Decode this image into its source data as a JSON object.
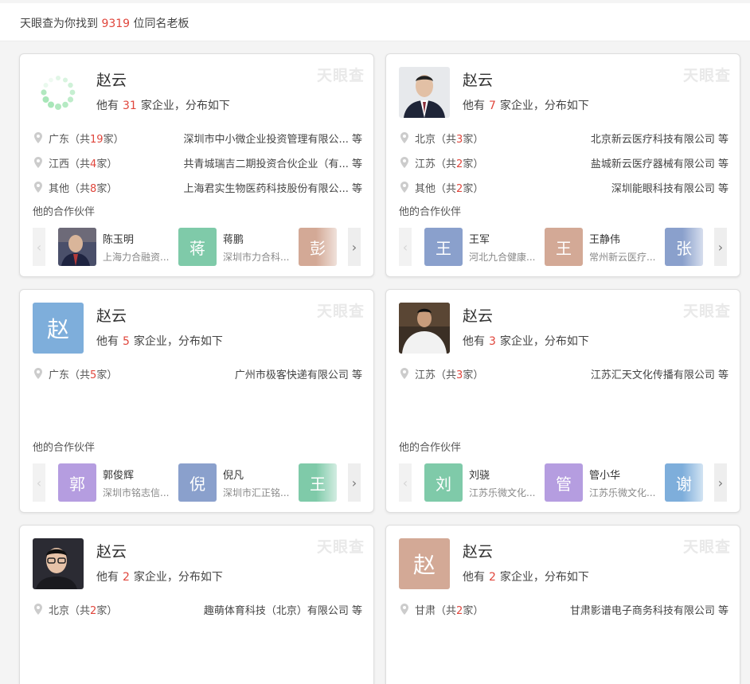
{
  "header": {
    "prefix": "天眼查为你找到",
    "count": "9319",
    "suffix": "位同名老板"
  },
  "watermark": "天眼查",
  "colors": {
    "accent_red": "#e0463c",
    "blue": "#7eaedb",
    "tan": "#d3a996",
    "green": "#7fcaa9",
    "purple": "#b59de0",
    "slate": "#8aa0cc"
  },
  "labels": {
    "count_prefix": "他有",
    "count_suffix": "家企业，分布如下",
    "partners_title": "他的合作伙伴",
    "etc": "等",
    "total_open": "（共",
    "total_close": "家）"
  },
  "cards": [
    {
      "name": "赵云",
      "count": "31",
      "avatar_type": "spinner",
      "locations": [
        {
          "province": "广东",
          "total": "19",
          "company": "深圳市中小微企业投资管理有限公..."
        },
        {
          "province": "江西",
          "total": "4",
          "company": "共青城瑞吉二期投资合伙企业（有..."
        },
        {
          "province": "其他",
          "total": "8",
          "company": "上海君实生物医药科技股份有限公..."
        }
      ],
      "partners": [
        {
          "name": "陈玉明",
          "company": "上海力合融资...",
          "avatar_type": "photo"
        },
        {
          "name": "蒋鹏",
          "company": "深圳市力合科...",
          "char": "蒋",
          "color": "#7fcaa9"
        },
        {
          "name": "",
          "company": "",
          "char": "彭",
          "color": "#d3a996"
        }
      ]
    },
    {
      "name": "赵云",
      "count": "7",
      "avatar_type": "photo",
      "locations": [
        {
          "province": "北京",
          "total": "3",
          "company": "北京新云医疗科技有限公司"
        },
        {
          "province": "江苏",
          "total": "2",
          "company": "盐城新云医疗器械有限公司"
        },
        {
          "province": "其他",
          "total": "2",
          "company": "深圳能眼科技有限公司"
        }
      ],
      "partners": [
        {
          "name": "王军",
          "company": "河北九合健康...",
          "char": "王",
          "color": "#8aa0cc"
        },
        {
          "name": "王静伟",
          "company": "常州新云医疗...",
          "char": "王",
          "color": "#d3a996"
        },
        {
          "name": "",
          "company": "",
          "char": "张",
          "color": "#8aa0cc"
        }
      ]
    },
    {
      "name": "赵云",
      "count": "5",
      "avatar_char": "赵",
      "avatar_color": "#7eaedb",
      "locations": [
        {
          "province": "广东",
          "total": "5",
          "company": "广州市极客快递有限公司"
        }
      ],
      "partners": [
        {
          "name": "郭俊辉",
          "company": "深圳市铭志信...",
          "char": "郭",
          "color": "#b59de0"
        },
        {
          "name": "倪凡",
          "company": "深圳市汇正铭...",
          "char": "倪",
          "color": "#8aa0cc"
        },
        {
          "name": "",
          "company": "",
          "char": "王",
          "color": "#7fcaa9"
        }
      ]
    },
    {
      "name": "赵云",
      "count": "3",
      "avatar_type": "photo",
      "locations": [
        {
          "province": "江苏",
          "total": "3",
          "company": "江苏汇天文化传播有限公司"
        }
      ],
      "partners": [
        {
          "name": "刘骁",
          "company": "江苏乐微文化...",
          "char": "刘",
          "color": "#7fcaa9"
        },
        {
          "name": "管小华",
          "company": "江苏乐微文化...",
          "char": "管",
          "color": "#b59de0"
        },
        {
          "name": "",
          "company": "",
          "char": "谢",
          "color": "#7eaedb"
        }
      ]
    },
    {
      "name": "赵云",
      "count": "2",
      "avatar_type": "photo",
      "locations": [
        {
          "province": "北京",
          "total": "2",
          "company": "趣萌体育科技（北京）有限公司"
        }
      ]
    },
    {
      "name": "赵云",
      "count": "2",
      "avatar_char": "赵",
      "avatar_color": "#d3a996",
      "locations": [
        {
          "province": "甘肃",
          "total": "2",
          "company": "甘肃影谱电子商务科技有限公司"
        }
      ]
    }
  ]
}
